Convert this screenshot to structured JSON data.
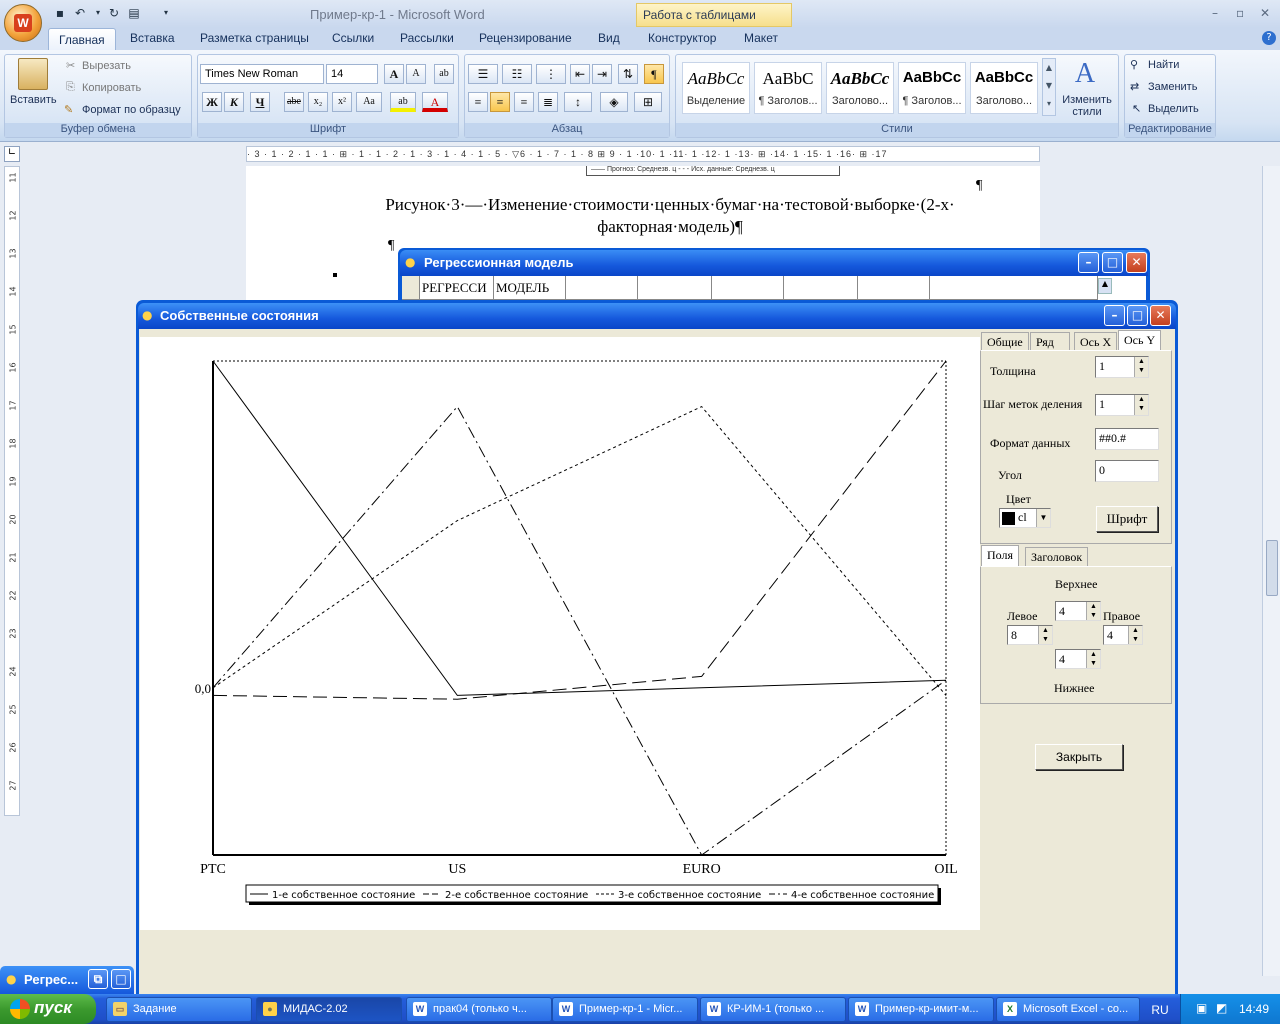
{
  "word": {
    "doc_title": "Пример-кр-1 - Microsoft Word",
    "context_tab": "Работа с таблицами",
    "tabs": [
      "Главная",
      "Вставка",
      "Разметка страницы",
      "Ссылки",
      "Рассылки",
      "Рецензирование",
      "Вид",
      "Конструктор",
      "Макет"
    ],
    "clipboard": {
      "paste": "Вставить",
      "cut": "Вырезать",
      "copy": "Копировать",
      "format_painter": "Формат по образцу",
      "label": "Буфер обмена"
    },
    "font": {
      "name": "Times New Roman",
      "size": "14",
      "label": "Шрифт",
      "bold": "Ж",
      "italic": "К",
      "underline": "Ч",
      "strike": "abe",
      "sub": "x₂",
      "sup": "x²",
      "case": "Аа",
      "grow": "A",
      "shrink": "A"
    },
    "paragraph": {
      "label": "Абзац"
    },
    "styles": {
      "label": "Стили",
      "items": [
        {
          "preview": "AaBbCc",
          "name": "Выделение"
        },
        {
          "preview": "AaBbC",
          "name": "¶ Заголов..."
        },
        {
          "preview": "AaBbCc",
          "name": "Заголово..."
        },
        {
          "preview": "AaBbCc",
          "name": "¶ Заголов..."
        },
        {
          "preview": "AaBbCc",
          "name": "Заголово..."
        }
      ],
      "change": "Изменить стили"
    },
    "editing": {
      "find": "Найти",
      "replace": "Заменить",
      "select": "Выделить",
      "label": "Редактирование"
    },
    "ruler": "· 3 · 1 · 2 · 1 · 1 · ⊞ · 1 · 1 · 2 · 1 · 3 · 1 · 4 · 1 · 5 · ▽6 · 1 · 7 · 1 · 8 ⊞ 9 · 1 ·10· 1 ·11· 1 ·12· 1 ·13· ⊞ ·14· 1 ·15· 1 ·16· ⊞ ·17",
    "vruler": [
      "11",
      "12",
      "13",
      "14",
      "15",
      "16",
      "17",
      "18",
      "19",
      "20",
      "21",
      "22",
      "23",
      "24",
      "25",
      "26",
      "27"
    ],
    "caption_line1": "Рисунок·3·—·Изменение·стоимости·ценных·бумаг·на·тестовой·выборке·(2-х·",
    "caption_line2": "факторная·модель)¶",
    "pilcrow": "¶",
    "legend_strip": "—— Прогноз: Среднезв. ц    - - -  Исх. данные: Среднезв. ц"
  },
  "reg_window": {
    "title": "Регрессионная модель",
    "cells": [
      "",
      "РЕГРЕССИ",
      "МОДЕЛЬ",
      "",
      "",
      "",
      "",
      "",
      ""
    ]
  },
  "dialog": {
    "title": "Собственные состояния",
    "tabs": [
      "Общие",
      "Ряд",
      "Ось X",
      "Ось Y"
    ],
    "thickness_label": "Толщина",
    "thickness": "1",
    "tick_step_label": "Шаг меток деления",
    "tick_step": "1",
    "format_label": "Формат данных",
    "format": "##0.#",
    "angle_label": "Угол",
    "angle": "0",
    "color_label": "Цвет",
    "color_value": "cl",
    "font_button": "Шрифт",
    "subtabs": [
      "Поля",
      "Заголовок"
    ],
    "top_label": "Верхнее",
    "left_label": "Левое",
    "right_label": "Правое",
    "bottom_label": "Нижнее",
    "top": "4",
    "left": "8",
    "right": "4",
    "bottom": "4",
    "close_button": "Закрыть"
  },
  "chart_data": {
    "type": "line",
    "categories": [
      "PTC",
      "US",
      "EURO",
      "OIL"
    ],
    "y_tick_labels": [
      "0,0"
    ],
    "series": [
      {
        "name": "1-е собственное состояние",
        "style": "solid",
        "values": [
          0.86,
          -0.02,
          0.0,
          0.02
        ]
      },
      {
        "name": "2-е собственное состояние",
        "style": "long-dash",
        "values": [
          -0.02,
          -0.03,
          0.03,
          0.86
        ]
      },
      {
        "name": "3-е собственное состояние",
        "style": "dotted",
        "values": [
          0.0,
          0.44,
          0.74,
          -0.02
        ]
      },
      {
        "name": "4-е собственное состояние",
        "style": "dash-dot",
        "values": [
          0.0,
          0.74,
          -0.44,
          0.02
        ]
      }
    ],
    "ylim": [
      -0.44,
      0.86
    ],
    "grid": false,
    "legend_position": "bottom"
  },
  "taskbar": {
    "minimized": "Регрес...",
    "start": "пуск",
    "items": [
      "Задание",
      "МИДАС-2.02",
      "прак04 (только ч...",
      "Пример-кр-1 - Micr...",
      "КР-ИМ-1 (только ...",
      "Пример-кр-имит-м...",
      "Microsoft Excel - co..."
    ],
    "lang": "RU",
    "time": "14:49"
  },
  "colors": {
    "xp_title": "#1558dc",
    "dialog_bg": "#ece9d8",
    "ribbon": "#d7e4f4"
  }
}
